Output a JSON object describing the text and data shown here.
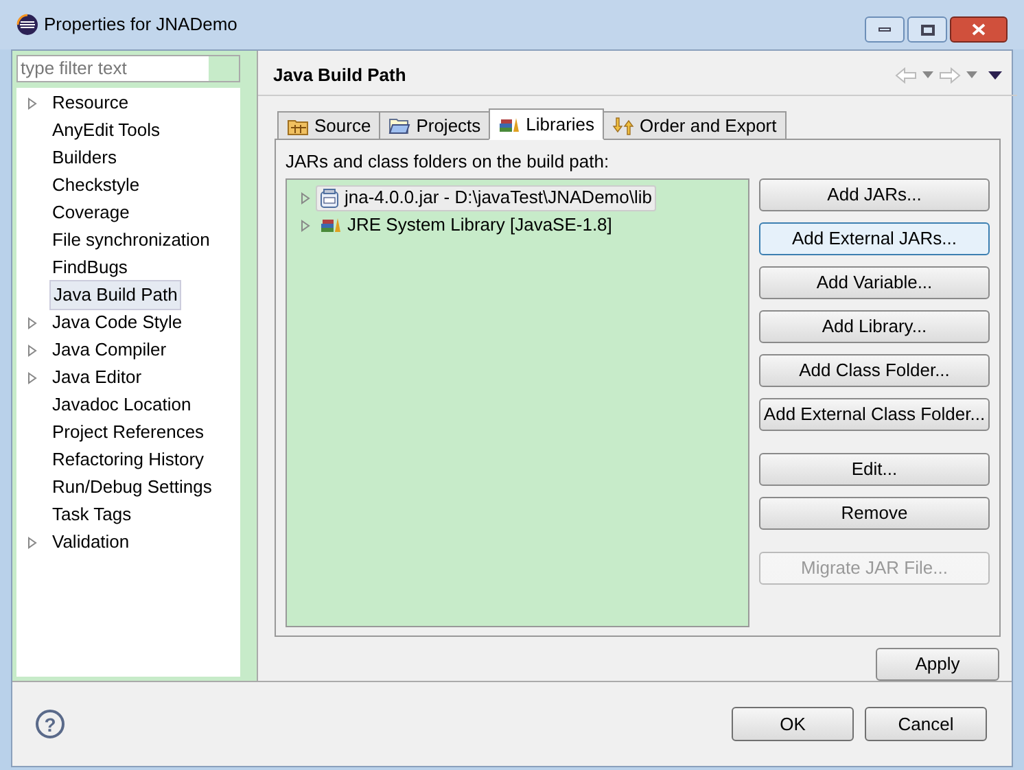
{
  "window": {
    "title": "Properties for JNADemo"
  },
  "filter": {
    "placeholder": "type filter text"
  },
  "tree": [
    {
      "label": "Resource",
      "expandable": true,
      "selected": false
    },
    {
      "label": "AnyEdit Tools",
      "expandable": false,
      "selected": false
    },
    {
      "label": "Builders",
      "expandable": false,
      "selected": false
    },
    {
      "label": "Checkstyle",
      "expandable": false,
      "selected": false
    },
    {
      "label": "Coverage",
      "expandable": false,
      "selected": false
    },
    {
      "label": "File synchronization",
      "expandable": false,
      "selected": false
    },
    {
      "label": "FindBugs",
      "expandable": false,
      "selected": false
    },
    {
      "label": "Java Build Path",
      "expandable": false,
      "selected": true
    },
    {
      "label": "Java Code Style",
      "expandable": true,
      "selected": false
    },
    {
      "label": "Java Compiler",
      "expandable": true,
      "selected": false
    },
    {
      "label": "Java Editor",
      "expandable": true,
      "selected": false
    },
    {
      "label": "Javadoc Location",
      "expandable": false,
      "selected": false
    },
    {
      "label": "Project References",
      "expandable": false,
      "selected": false
    },
    {
      "label": "Refactoring History",
      "expandable": false,
      "selected": false
    },
    {
      "label": "Run/Debug Settings",
      "expandable": false,
      "selected": false
    },
    {
      "label": "Task Tags",
      "expandable": false,
      "selected": false
    },
    {
      "label": "Validation",
      "expandable": true,
      "selected": false
    }
  ],
  "page": {
    "title": "Java Build Path"
  },
  "tabs": [
    {
      "label": "Source",
      "kind": "source",
      "selected": false
    },
    {
      "label": "Projects",
      "kind": "projects",
      "selected": false
    },
    {
      "label": "Libraries",
      "kind": "libraries",
      "selected": true
    },
    {
      "label": "Order and Export",
      "kind": "order",
      "selected": false
    }
  ],
  "libraries": {
    "caption": "JARs and class folders on the build path:",
    "entries": [
      {
        "label": "jna-4.0.0.jar - D:\\javaTest\\JNADemo\\lib",
        "kind": "jar",
        "selected": true
      },
      {
        "label": "JRE System Library [JavaSE-1.8]",
        "kind": "library",
        "selected": false
      }
    ]
  },
  "button_groups": [
    [
      {
        "label": "Add JARs...",
        "focused": false,
        "disabled": false
      },
      {
        "label": "Add External JARs...",
        "focused": true,
        "disabled": false
      },
      {
        "label": "Add Variable...",
        "focused": false,
        "disabled": false
      },
      {
        "label": "Add Library...",
        "focused": false,
        "disabled": false
      },
      {
        "label": "Add Class Folder...",
        "focused": false,
        "disabled": false
      },
      {
        "label": "Add External Class Folder...",
        "focused": false,
        "disabled": false
      }
    ],
    [
      {
        "label": "Edit...",
        "focused": false,
        "disabled": false
      },
      {
        "label": "Remove",
        "focused": false,
        "disabled": false
      }
    ],
    [
      {
        "label": "Migrate JAR File...",
        "focused": false,
        "disabled": true
      }
    ]
  ],
  "apply": "Apply",
  "footer": {
    "help": "?",
    "buttons": [
      "OK",
      "Cancel"
    ]
  }
}
